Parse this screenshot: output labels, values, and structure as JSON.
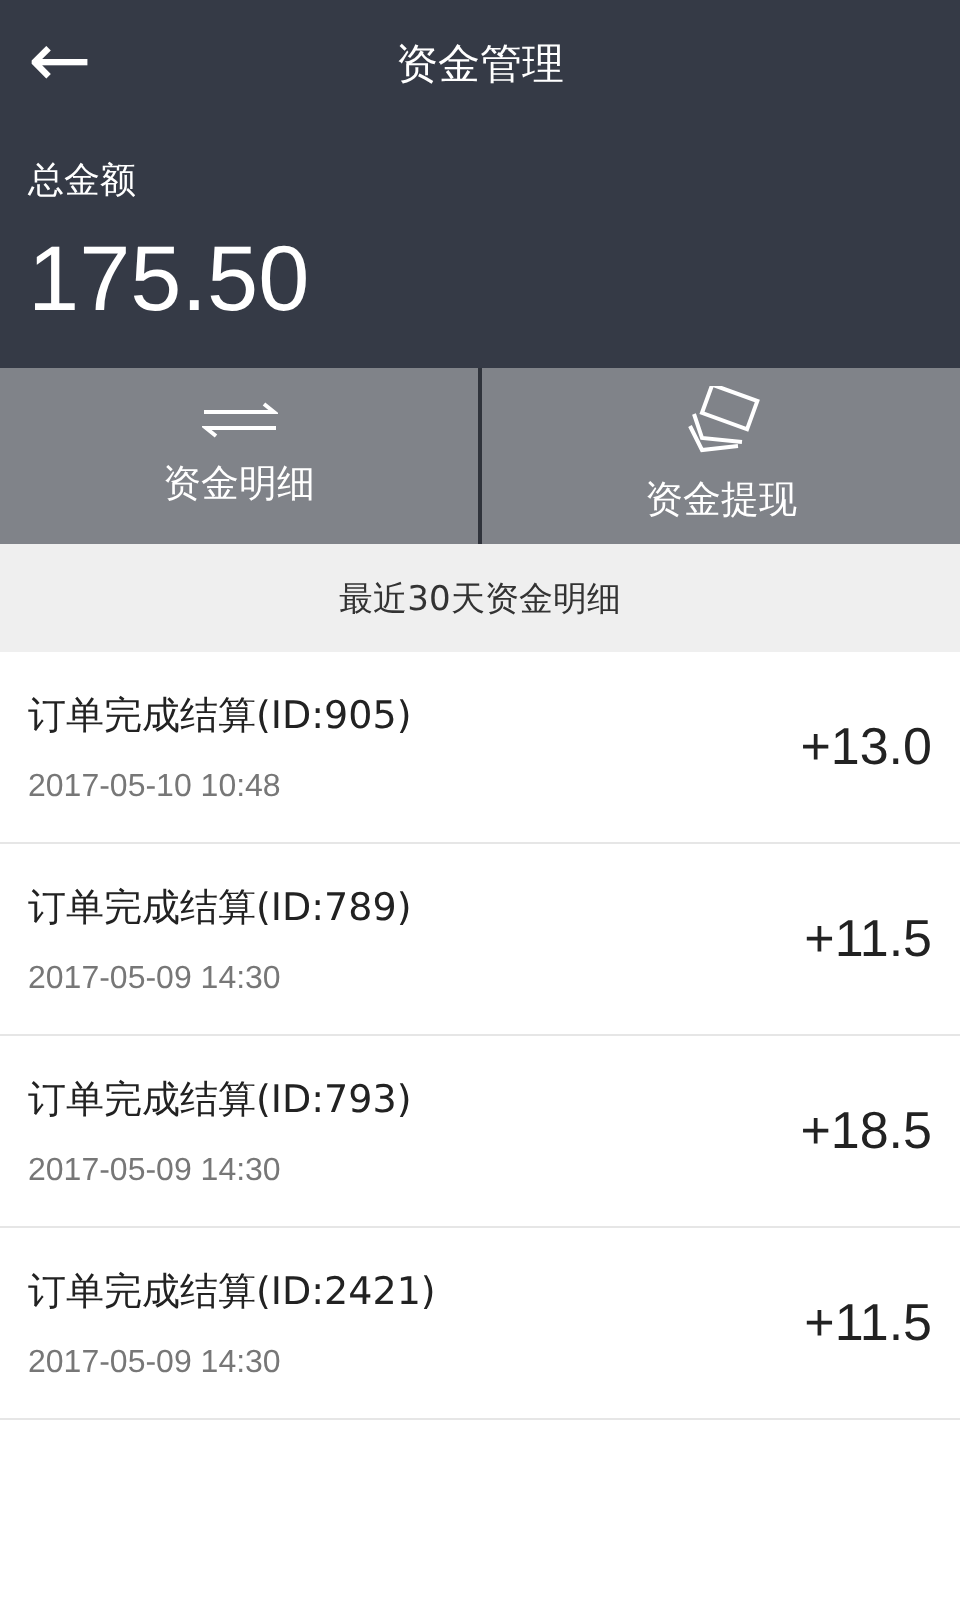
{
  "header": {
    "back": "←",
    "title": "资金管理"
  },
  "balance": {
    "label": "总金额",
    "amount": "175.50"
  },
  "actions": [
    {
      "kind": "transfer",
      "label": "资金明细"
    },
    {
      "kind": "cash",
      "label": "资金提现"
    }
  ],
  "section_title": "最近30天资金明细",
  "records": [
    {
      "title": "订单完成结算(ID:905)",
      "time": "2017-05-10 10:48",
      "amount": "+13.0"
    },
    {
      "title": "订单完成结算(ID:789)",
      "time": "2017-05-09 14:30",
      "amount": "+11.5"
    },
    {
      "title": "订单完成结算(ID:793)",
      "time": "2017-05-09 14:30",
      "amount": "+18.5"
    },
    {
      "title": "订单完成结算(ID:2421)",
      "time": "2017-05-09 14:30",
      "amount": "+11.5"
    }
  ]
}
